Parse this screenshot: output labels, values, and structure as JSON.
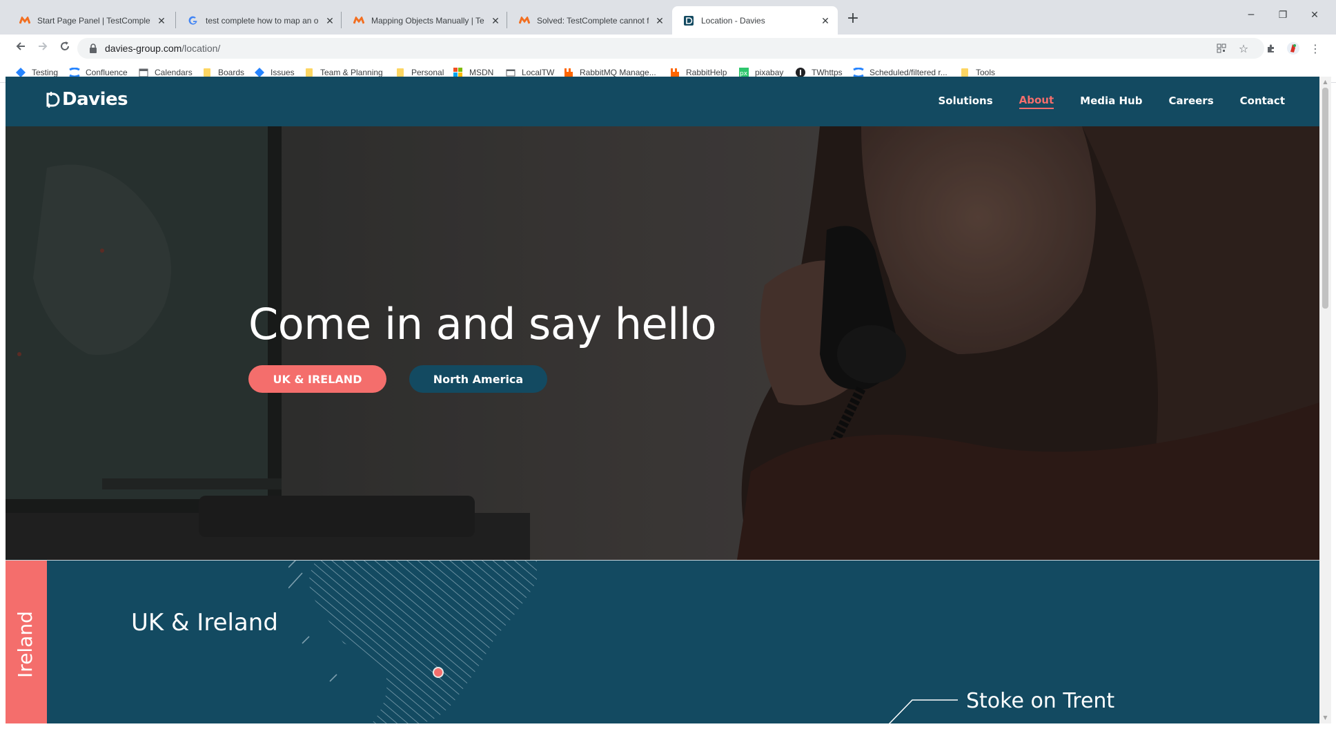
{
  "browser": {
    "tabs": [
      {
        "title": "Start Page Panel | TestComplete D",
        "favicon": "smartbear-icon",
        "active": false
      },
      {
        "title": "test complete how to map an obj",
        "favicon": "google-icon",
        "active": false
      },
      {
        "title": "Mapping Objects Manually | Test",
        "favicon": "smartbear-icon",
        "active": false
      },
      {
        "title": "Solved: TestComplete cannot find",
        "favicon": "smartbear-icon",
        "active": false
      },
      {
        "title": "Location - Davies",
        "favicon": "davies-icon",
        "active": true
      }
    ],
    "url_host": "davies-group.com",
    "url_path": "/location/",
    "bookmarks": [
      {
        "label": "Testing",
        "icon": "jira-icon"
      },
      {
        "label": "Confluence",
        "icon": "confluence-icon"
      },
      {
        "label": "Calendars",
        "icon": "calendar-icon"
      },
      {
        "label": "Boards",
        "icon": "folder-icon"
      },
      {
        "label": "Issues",
        "icon": "jira-icon"
      },
      {
        "label": "Team & Planning",
        "icon": "folder-icon"
      },
      {
        "label": "Personal",
        "icon": "folder-icon"
      },
      {
        "label": "MSDN",
        "icon": "microsoft-icon"
      },
      {
        "label": "LocalTW",
        "icon": "page-icon"
      },
      {
        "label": "RabbitMQ Manage...",
        "icon": "rabbitmq-icon"
      },
      {
        "label": "RabbitHelp",
        "icon": "rabbitmq-icon"
      },
      {
        "label": "pixabay",
        "icon": "pixabay-icon"
      },
      {
        "label": "TWhttps",
        "icon": "circle-icon"
      },
      {
        "label": "Scheduled/filtered r...",
        "icon": "confluence-icon"
      },
      {
        "label": "Tools",
        "icon": "folder-icon"
      }
    ]
  },
  "site": {
    "logo_text": "Davies",
    "nav": [
      {
        "label": "Solutions",
        "active": false
      },
      {
        "label": "About",
        "active": true
      },
      {
        "label": "Media Hub",
        "active": false
      },
      {
        "label": "Careers",
        "active": false
      },
      {
        "label": "Contact",
        "active": false
      }
    ],
    "hero": {
      "title": "Come in and say hello",
      "buttons": [
        "UK & IRELAND",
        "North America"
      ]
    },
    "location": {
      "side_tab": "Ireland",
      "title": "UK & Ireland",
      "city": "Stoke on Trent"
    },
    "colors": {
      "brand_teal": "#134a61",
      "accent_coral": "#f46e6c"
    }
  }
}
